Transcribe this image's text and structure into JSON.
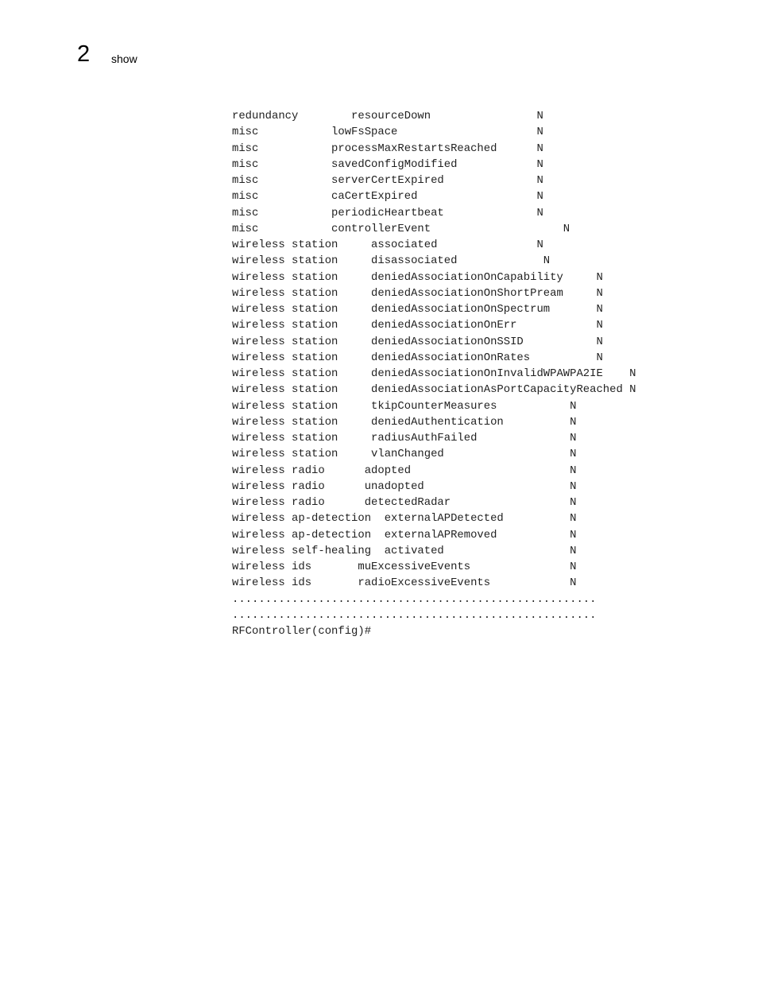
{
  "header": {
    "chapter_number": "2",
    "chapter_title": "show"
  },
  "cli_output": {
    "lines": [
      "redundancy        resourceDown                N",
      "misc           lowFsSpace                     N",
      "misc           processMaxRestartsReached      N",
      "misc           savedConfigModified            N",
      "misc           serverCertExpired              N",
      "misc           caCertExpired                  N",
      "misc           periodicHeartbeat              N",
      "misc           controllerEvent                    N",
      "wireless station     associated               N",
      "wireless station     disassociated             N",
      "wireless station     deniedAssociationOnCapability     N",
      "wireless station     deniedAssociationOnShortPream     N",
      "wireless station     deniedAssociationOnSpectrum       N",
      "wireless station     deniedAssociationOnErr            N",
      "wireless station     deniedAssociationOnSSID           N",
      "wireless station     deniedAssociationOnRates          N",
      "wireless station     deniedAssociationOnInvalidWPAWPA2IE    N",
      "wireless station     deniedAssociationAsPortCapacityReached N",
      "wireless station     tkipCounterMeasures           N",
      "wireless station     deniedAuthentication          N",
      "wireless station     radiusAuthFailed              N",
      "wireless station     vlanChanged                   N",
      "wireless radio      adopted                        N",
      "wireless radio      unadopted                      N",
      "wireless radio      detectedRadar                  N",
      "wireless ap-detection  externalAPDetected          N",
      "wireless ap-detection  externalAPRemoved           N",
      "wireless self-healing  activated                   N",
      "wireless ids       muExcessiveEvents               N",
      "wireless ids       radioExcessiveEvents            N",
      ".......................................................",
      ".......................................................",
      "RFController(config)#"
    ]
  }
}
